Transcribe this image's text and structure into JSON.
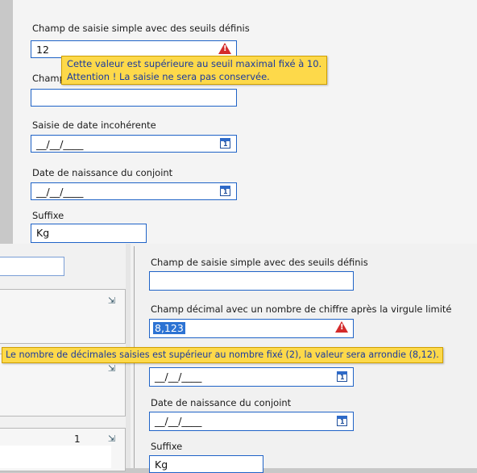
{
  "top_form": {
    "field1_label": "Champ de saisie simple avec des seuils définis",
    "field1_value": "12",
    "tooltip1_line1": "Cette valeur est supérieure au seuil maximal fixé à 10.",
    "tooltip1_line2": "Attention ! La saisie ne sera pas conservée.",
    "field2_label_partial": "Champ",
    "field3_label": "Saisie de date incohérente",
    "field3_value": "__/__/____",
    "field4_label": "Date de naissance du conjoint",
    "field4_value": "__/__/____",
    "suffix_label": "Suffixe",
    "suffix_value": "Kg"
  },
  "bottom_form": {
    "field1_label": "Champ de saisie simple avec des seuils définis",
    "field2_label": "Champ décimal avec un nombre de chiffre après la virgule limité",
    "field2_value": "8,123",
    "tooltip2": "Le nombre de décimales saisies est supérieur au nombre fixé (2), la valeur sera arrondie (8,12).",
    "date_value": "__/__/____",
    "field4_label": "Date de naissance du conjoint",
    "field4_value": "__/__/____",
    "suffix_label": "Suffixe",
    "suffix_value": "Kg",
    "left_number": "1"
  },
  "icons": {
    "warning": "warning-triangle-icon",
    "calendar": "calendar-icon",
    "tree": "tree-branch-icon"
  },
  "colors": {
    "field_border": "#1f63c7",
    "tooltip_bg": "#fdd94a",
    "warning": "#d42b2b",
    "selection": "#2d73d3"
  }
}
